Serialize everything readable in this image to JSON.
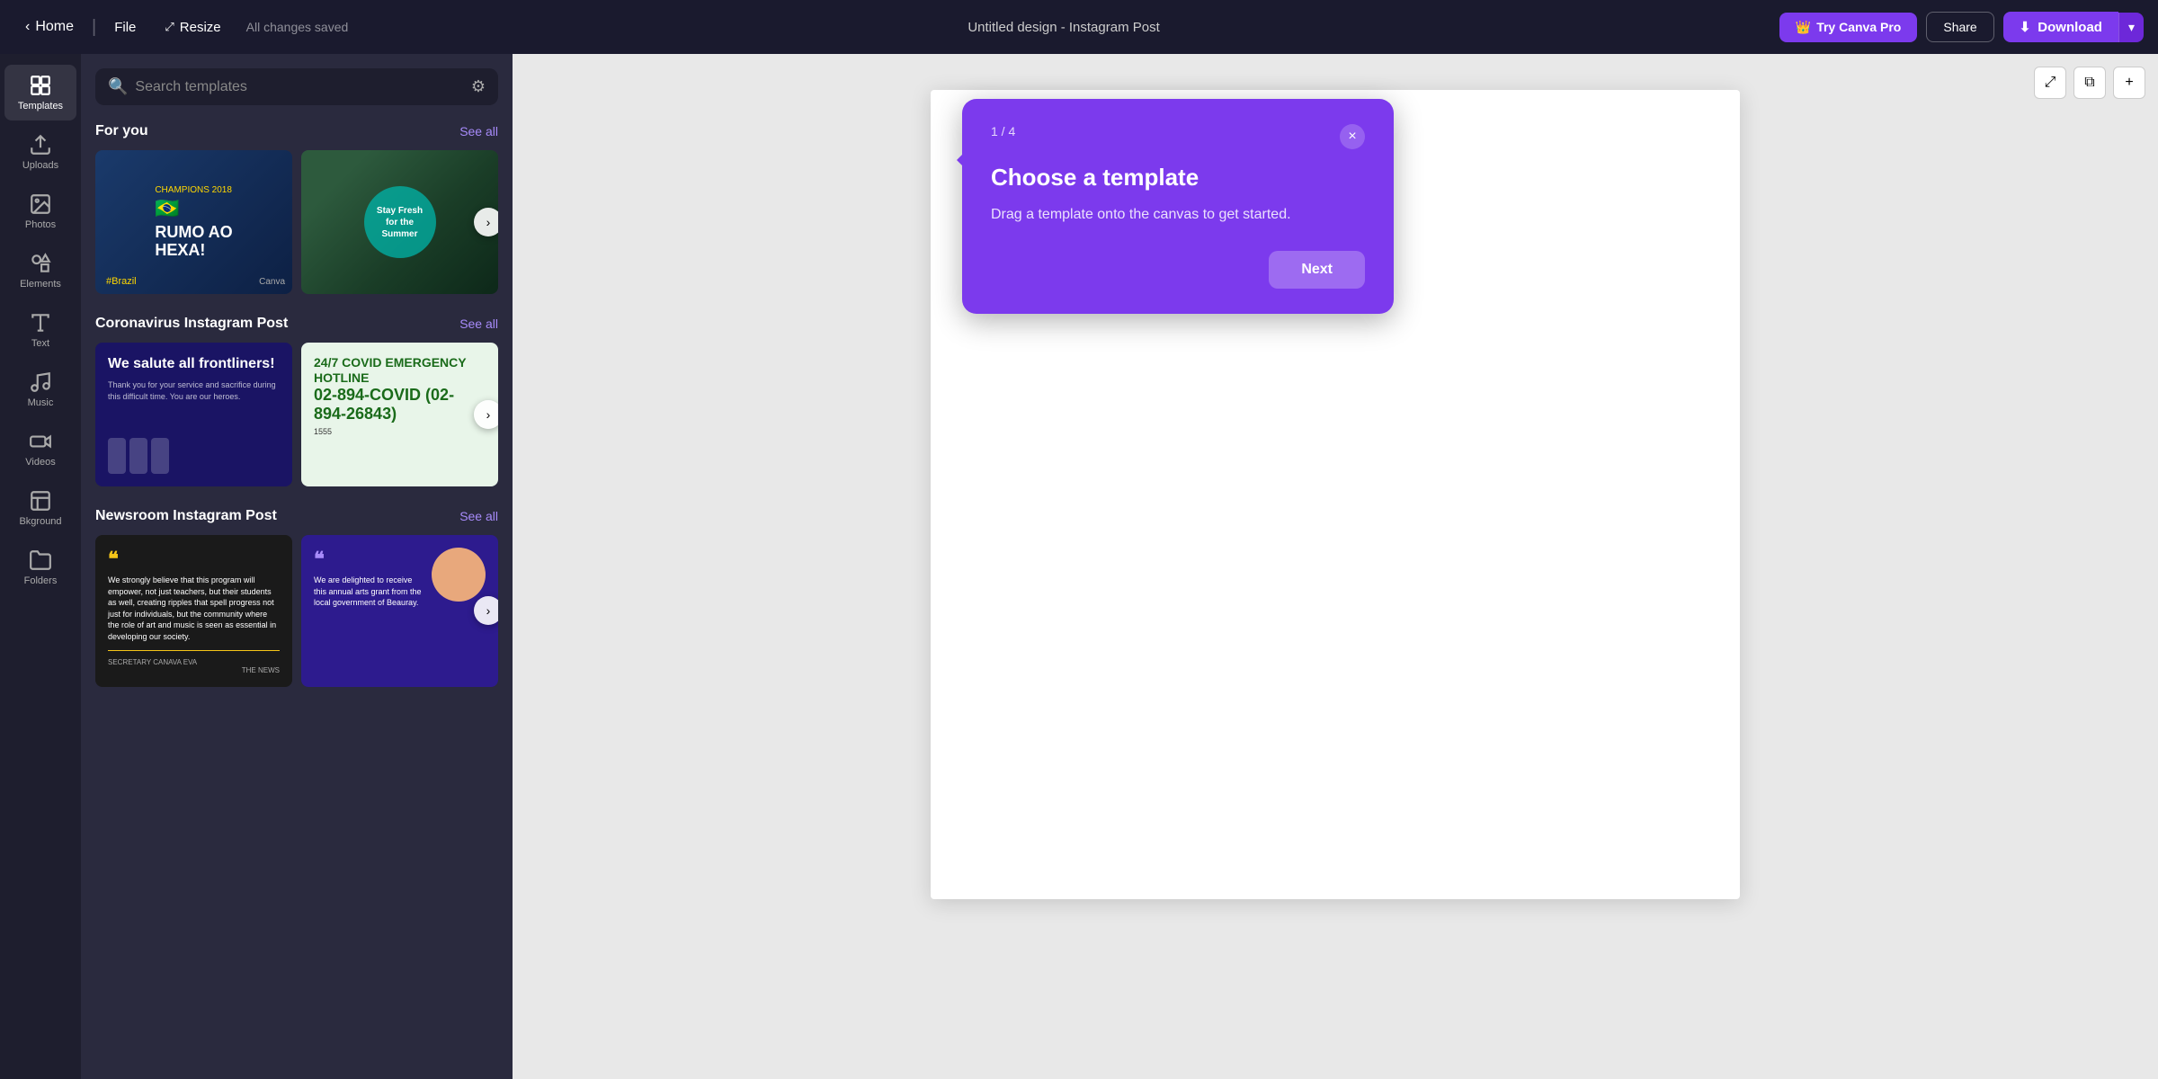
{
  "topbar": {
    "home_label": "Home",
    "file_label": "File",
    "resize_label": "Resize",
    "saved_text": "All changes saved",
    "title": "Untitled design - Instagram Post",
    "try_pro_label": "Try Canva Pro",
    "share_label": "Share",
    "download_label": "Download"
  },
  "sidebar": {
    "items": [
      {
        "id": "templates",
        "label": "Templates",
        "icon": "grid"
      },
      {
        "id": "uploads",
        "label": "Uploads",
        "icon": "upload"
      },
      {
        "id": "photos",
        "label": "Photos",
        "icon": "image"
      },
      {
        "id": "elements",
        "label": "Elements",
        "icon": "shapes"
      },
      {
        "id": "text",
        "label": "Text",
        "icon": "text"
      },
      {
        "id": "music",
        "label": "Music",
        "icon": "music"
      },
      {
        "id": "videos",
        "label": "Videos",
        "icon": "video"
      },
      {
        "id": "background",
        "label": "Bkground",
        "icon": "background"
      },
      {
        "id": "folders",
        "label": "Folders",
        "icon": "folder"
      }
    ]
  },
  "templates_panel": {
    "search_placeholder": "Search templates",
    "sections": [
      {
        "id": "for_you",
        "title": "For you",
        "see_all": "See all"
      },
      {
        "id": "coronavirus",
        "title": "Coronavirus Instagram Post",
        "see_all": "See all"
      },
      {
        "id": "newsroom",
        "title": "Newsroom Instagram Post",
        "see_all": "See all"
      }
    ],
    "brazil_card": {
      "flag": "🇧🇷",
      "line1": "RUMO AO",
      "line2": "HEXA!",
      "hashtag": "#Brazil",
      "badge": "CHAMPIONS 2018"
    },
    "fruits_card": {
      "circle_text": "Stay Fresh for the Summer"
    },
    "covid_dark": {
      "title": "We salute all frontliners!",
      "sub": "Thank you for your service and sacrifice during this difficult time.\nYou are our heroes."
    },
    "covid_light": {
      "title": "24/7 COVID EMERGENCY HOTLINE",
      "number": "02-894-COVID (02-894-26843)",
      "sub": "1555"
    },
    "news_dark": {
      "quote": "❝",
      "text": "We strongly believe that this program will empower, not just teachers, but their students as well, creating ripples that spell progress not just for individuals, but the community where the role of art and music is seen as essential in developing our society."
    },
    "news_purple": {
      "quote": "❝",
      "text": "We are delighted to receive this annual arts grant from the local government of Beauray."
    }
  },
  "tooltip": {
    "counter": "1 / 4",
    "title": "Choose a template",
    "description": "Drag a template onto the canvas to get started.",
    "next_label": "Next",
    "close_icon": "×"
  },
  "canvas_toolbar": {
    "expand_icon": "⤢",
    "duplicate_icon": "⧉",
    "add_icon": "+"
  }
}
